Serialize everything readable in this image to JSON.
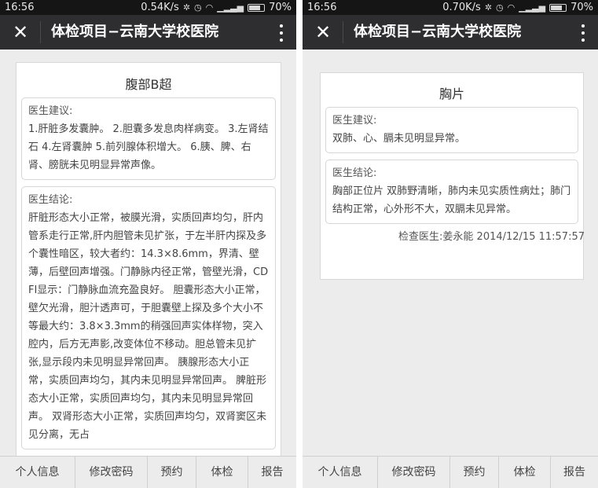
{
  "left": {
    "status": {
      "time": "16:56",
      "speed": "0.54K/s",
      "battery": "70%",
      "battery_level": 0.7
    },
    "header": {
      "close_icon": "close-icon",
      "title": "体检项目−云南大学校医院",
      "more_icon": "more-vert-icon"
    },
    "card": {
      "title": "腹部B超",
      "advice_label": "医生建议:",
      "advice_text": "1.肝脏多发囊肿。 2.胆囊多发息肉样病变。 3.左肾结石 4.左肾囊肿 5.前列腺体积增大。 6.胰、脾、右肾、膀胱未见明显异常声像。",
      "conclusion_label": "医生结论:",
      "conclusion_text": "肝脏形态大小正常，被膜光滑，实质回声均匀，肝内管系走行正常,肝内胆管未见扩张，于左半肝内探及多个囊性暗区，较大者约：14.3×8.6mm，界清、壁薄，后壁回声增强。门静脉内径正常，管壁光滑，CDFI显示：门静脉血流充盈良好。 胆囊形态大小正常，壁欠光滑，胆汁透声可，于胆囊壁上探及多个大小不等最大约：3.8×3.3mm的稍强回声实体样物，突入腔内，后方无声影,改变体位不移动。胆总管未见扩张,显示段内未见明显异常回声。 胰腺形态大小正常，实质回声均匀，其内未见明显异常回声。 脾脏形态大小正常，实质回声均匀，其内未见明显异常回声。 双肾形态大小正常，实质回声均匀，双肾窦区未见分离，无占"
    },
    "nav": [
      "个人信息",
      "修改密码",
      "预约",
      "体检",
      "报告"
    ]
  },
  "right": {
    "status": {
      "time": "16:56",
      "speed": "0.70K/s",
      "battery": "70%",
      "battery_level": 0.7
    },
    "header": {
      "close_icon": "close-icon",
      "title": "体检项目−云南大学校医院",
      "more_icon": "more-vert-icon"
    },
    "card": {
      "title": "胸片",
      "advice_label": "医生建议:",
      "advice_text": "双肺、心、膈未见明显异常。",
      "conclusion_label": "医生结论:",
      "conclusion_text": "胸部正位片 双肺野清晰，肺内未见实质性病灶；肺门结构正常，心外形不大，双膈未见异常。",
      "doctor_line": "检查医生:姜永能 2014/12/15 11:57:57"
    },
    "nav": [
      "个人信息",
      "修改密码",
      "预约",
      "体检",
      "报告"
    ]
  }
}
